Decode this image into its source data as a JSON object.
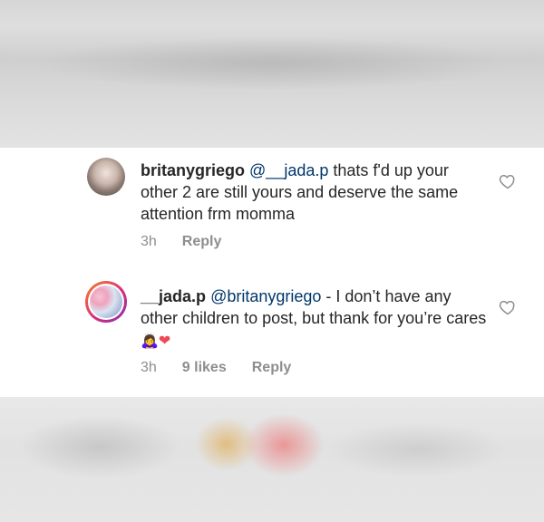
{
  "comments": [
    {
      "username": "britanygriego",
      "mention": "@__jada.p",
      "body": " thats f'd up your other 2 are still yours and deserve the same attention frm momma",
      "time": "3h",
      "likes": "",
      "reply": "Reply",
      "avatar_icon": "profile-photo",
      "like_icon": "heart-outline-icon"
    },
    {
      "username": "__jada.p",
      "mention": "@britanygriego",
      "body": " - I don’t have any other children to post, but thank for you’re cares ",
      "emojis": [
        "🙇‍♀️",
        "❤"
      ],
      "time": "3h",
      "likes": "9 likes",
      "reply": "Reply",
      "avatar_icon": "profile-photo-story-ring",
      "like_icon": "heart-outline-icon"
    }
  ],
  "colors": {
    "text": "#262626",
    "mention": "#00376b",
    "meta": "#8e8e8e",
    "heart": "#ed4956"
  }
}
